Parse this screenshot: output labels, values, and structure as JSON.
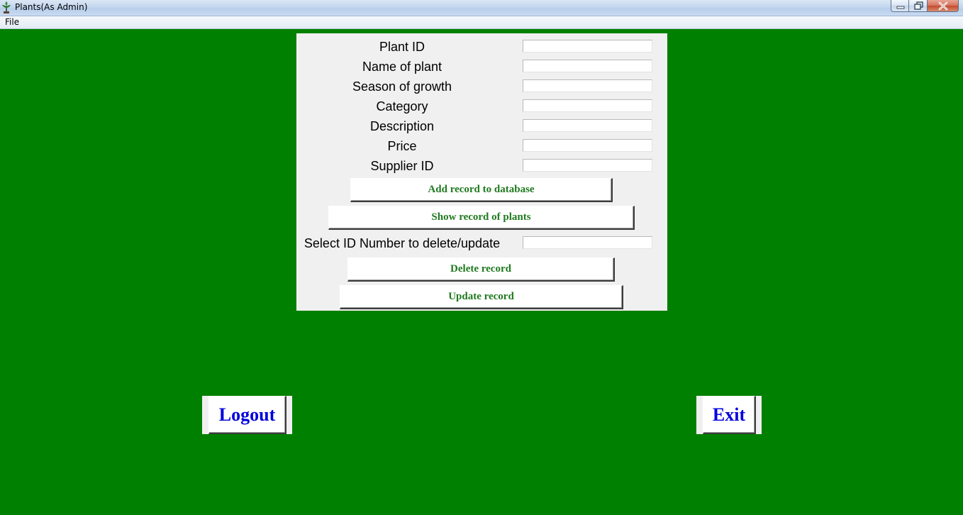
{
  "window": {
    "title": "Plants(As Admin)"
  },
  "menubar": {
    "items": [
      {
        "label": "File"
      }
    ]
  },
  "form": {
    "fields": [
      {
        "label": "Plant ID",
        "value": ""
      },
      {
        "label": "Name of plant",
        "value": ""
      },
      {
        "label": "Season of growth",
        "value": ""
      },
      {
        "label": "Category",
        "value": ""
      },
      {
        "label": "Description",
        "value": ""
      },
      {
        "label": "Price",
        "value": ""
      },
      {
        "label": "Supplier ID",
        "value": ""
      }
    ],
    "add_button": "Add record to database",
    "show_button": "Show record of plants",
    "select_label": "Select ID Number to delete/update",
    "select_value": "",
    "delete_button": "Delete record",
    "update_button": "Update record"
  },
  "actions": {
    "logout": "Logout",
    "exit": "Exit"
  },
  "colors": {
    "background": "#008000",
    "panel": "#f0f0f0",
    "button_text_form": "#1f7a1f",
    "button_text_big": "#0000dd"
  }
}
